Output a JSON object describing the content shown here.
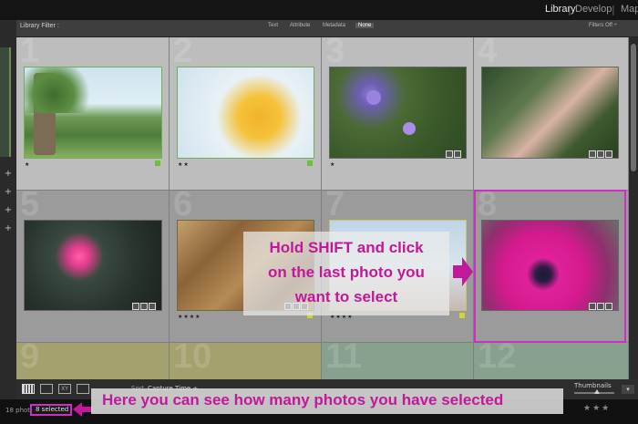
{
  "header": {
    "modules": [
      "Library",
      "Develop",
      "Map"
    ],
    "separator": "|"
  },
  "filter_bar": {
    "title": "Library Filter :",
    "options": [
      "Text",
      "Attribute",
      "Metadata",
      "None"
    ],
    "active_option": "None",
    "filters_off": "Filters Off ÷"
  },
  "grid": {
    "cells": [
      {
        "index": "1",
        "stars": "★",
        "subject": "park-tree"
      },
      {
        "index": "2",
        "stars": "★★",
        "subject": "yellow-flower"
      },
      {
        "index": "3",
        "stars": "★",
        "subject": "purple-daisies"
      },
      {
        "index": "4",
        "stars": "",
        "subject": "pampas-grass"
      },
      {
        "index": "5",
        "stars": "",
        "subject": "pink-puffball"
      },
      {
        "index": "6",
        "stars": "★★★★",
        "subject": "autumn-leaves"
      },
      {
        "index": "7",
        "stars": "★★★★",
        "subject": "blossom-branch"
      },
      {
        "index": "8",
        "stars": "",
        "subject": "magenta-anemone"
      },
      {
        "index": "9",
        "stars": "",
        "subject": ""
      },
      {
        "index": "10",
        "stars": "",
        "subject": ""
      },
      {
        "index": "11",
        "stars": "",
        "subject": ""
      },
      {
        "index": "12",
        "stars": "",
        "subject": ""
      }
    ]
  },
  "callout": {
    "lines": [
      "Hold SHIFT and click",
      "on the last photo you",
      "want to select"
    ]
  },
  "toolbar": {
    "sort_label": "Sort",
    "sort_value": "Capture Time ÷",
    "thumbnails_label": "Thumbnails"
  },
  "status": {
    "photo_count": "18 photos",
    "selected_count": "8 selected",
    "banner": "Here you can see how many photos you have selected"
  },
  "colors": {
    "accent": "#c2189a",
    "selection_outline": "#d32cc4",
    "flag_green": "#6fbf3b"
  }
}
